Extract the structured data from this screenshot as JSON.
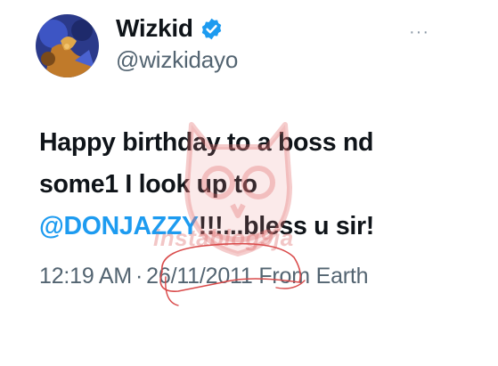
{
  "author": {
    "display_name": "Wizkid",
    "handle": "@wizkidayo",
    "verified": true
  },
  "more_label": "···",
  "tweet": {
    "line1": "Happy birthday to a boss nd",
    "line2": "some1 I look up to",
    "mention": "@DONJAZZY",
    "line3_rest": "!!!...bless u sir!"
  },
  "meta": {
    "time": "12:19 AM",
    "separator": "·",
    "date": "26/11/2011",
    "source": "From Earth"
  },
  "watermark": {
    "text": "instablog9ja"
  },
  "colors": {
    "accent": "#1d9bf0",
    "text": "#0f1419",
    "secondary": "#536471",
    "annotation": "#d94a4a"
  }
}
